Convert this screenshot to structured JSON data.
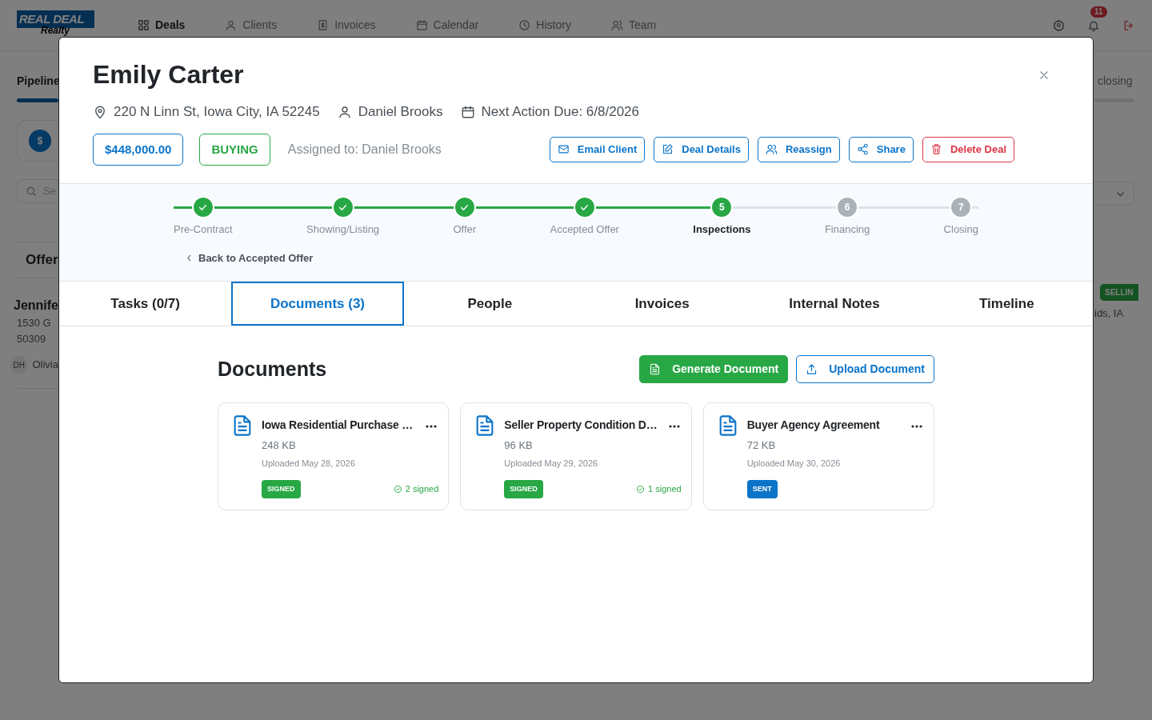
{
  "background": {
    "logo": {
      "name": "REAL DEAL",
      "tagline": "Realty"
    },
    "nav": [
      {
        "label": "Deals",
        "selected": true
      },
      {
        "label": "Clients",
        "selected": false
      },
      {
        "label": "Invoices",
        "selected": false
      },
      {
        "label": "Calendar",
        "selected": false
      },
      {
        "label": "History",
        "selected": false
      },
      {
        "label": "Team",
        "selected": false
      }
    ],
    "notification_count": "11",
    "left_panel": {
      "tab": "Pipeline",
      "summary_icon": "$",
      "search_placeholder": "Se",
      "column_title": "Offer",
      "card": {
        "name": "Jennife",
        "address_line_1": "1530 G",
        "address_line_2": "50309",
        "agent_initials": "DH",
        "agent": "Olivia"
      }
    },
    "right_panel": {
      "tab": "closing",
      "badge": "SELLIN",
      "address": "ids, IA"
    }
  },
  "modal": {
    "title": "Emily Carter",
    "address": "220 N Linn St, Iowa City, IA 52245",
    "agent": "Daniel Brooks",
    "next_action": "Next Action Due: 6/8/2026",
    "price": "$448,000.00",
    "deal_type": "BUYING",
    "assigned": "Assigned to: Daniel Brooks",
    "actions": [
      {
        "label": "Email Client",
        "kind": "primary"
      },
      {
        "label": "Deal Details",
        "kind": "primary"
      },
      {
        "label": "Reassign",
        "kind": "primary"
      },
      {
        "label": "Share",
        "kind": "primary"
      },
      {
        "label": "Delete Deal",
        "kind": "danger"
      }
    ],
    "steps": [
      {
        "label": "Pre-Contract",
        "completed": true,
        "current": false
      },
      {
        "label": "Showing/Listing",
        "completed": true,
        "current": false
      },
      {
        "label": "Offer",
        "completed": true,
        "current": false
      },
      {
        "label": "Accepted Offer",
        "completed": true,
        "current": false
      },
      {
        "label": "Inspections",
        "completed": false,
        "current": true,
        "number": "5"
      },
      {
        "label": "Financing",
        "completed": false,
        "current": false,
        "number": "6"
      },
      {
        "label": "Closing",
        "completed": false,
        "current": false,
        "number": "7"
      }
    ],
    "back_link": "Back to Accepted Offer",
    "tabs": [
      {
        "label": "Tasks (0/7)",
        "selected": false
      },
      {
        "label": "Documents (3)",
        "selected": true
      },
      {
        "label": "People",
        "selected": false
      },
      {
        "label": "Invoices",
        "selected": false
      },
      {
        "label": "Internal Notes",
        "selected": false
      },
      {
        "label": "Timeline",
        "selected": false
      }
    ],
    "documents": {
      "title": "Documents",
      "generate_button": "Generate Document",
      "upload_button": "Upload Document",
      "items": [
        {
          "name": "Iowa Residential Purchase …",
          "size": "248 KB",
          "uploaded": "Uploaded May 28, 2026",
          "badge": {
            "text": "SIGNED",
            "color": "#28a745"
          },
          "signed": "2 signed"
        },
        {
          "name": "Seller Property Condition D…",
          "size": "96 KB",
          "uploaded": "Uploaded May 29, 2026",
          "badge": {
            "text": "SIGNED",
            "color": "#28a745"
          },
          "signed": "1 signed"
        },
        {
          "name": "Buyer Agency Agreement",
          "size": "72 KB",
          "uploaded": "Uploaded May 30, 2026",
          "badge": {
            "text": "SENT",
            "color": "#0b74c9"
          }
        }
      ]
    }
  }
}
